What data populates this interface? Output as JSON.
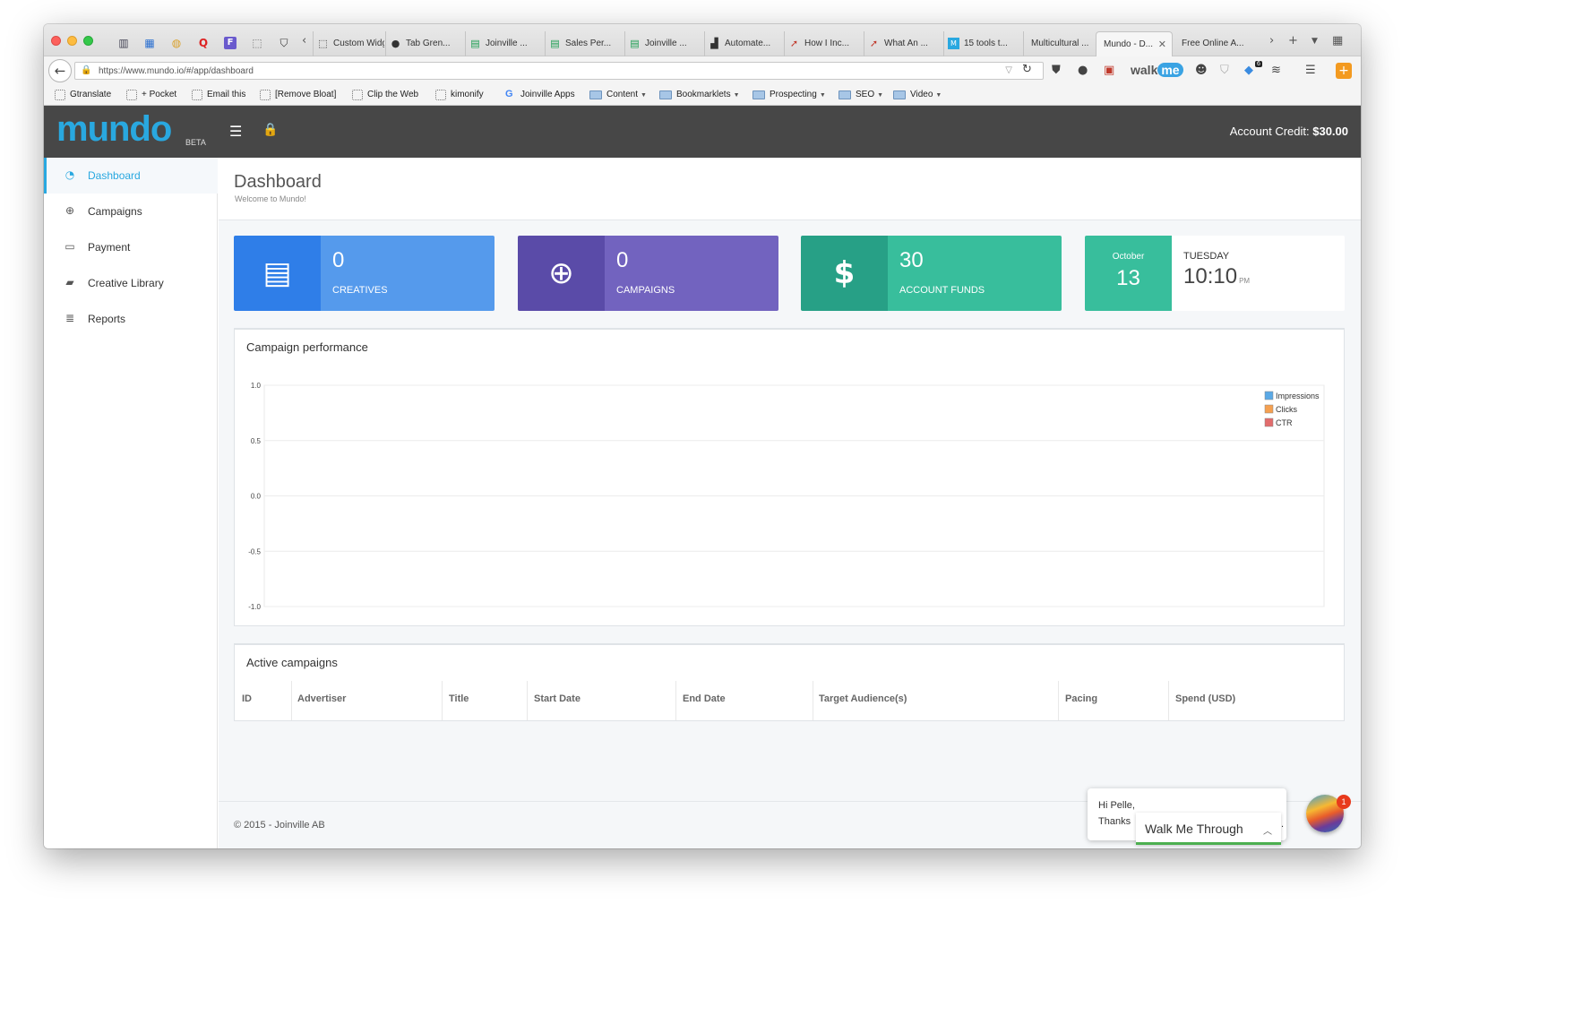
{
  "browser": {
    "tabs": [
      {
        "label": "Custom Widg...",
        "icon": "widget-icon"
      },
      {
        "label": "Tab Gren...",
        "icon": "grenade-icon"
      },
      {
        "label": "Joinville ...",
        "icon": "sheets-icon"
      },
      {
        "label": "Sales Per...",
        "icon": "sheets-icon"
      },
      {
        "label": "Joinville ...",
        "icon": "sheets-icon"
      },
      {
        "label": "Automate...",
        "icon": "chart-icon"
      },
      {
        "label": "How I Inc...",
        "icon": "rocket-icon"
      },
      {
        "label": "What An ...",
        "icon": "rocket-icon"
      },
      {
        "label": "15 tools t...",
        "icon": "doc-icon"
      },
      {
        "label": "Multicultural ...",
        "icon": "blank-icon"
      },
      {
        "label": "Mundo - D...",
        "icon": "blank-icon",
        "active": true
      },
      {
        "label": "Free Online A...",
        "icon": "blank-icon"
      }
    ],
    "url": "https://www.mundo.io/#/app/dashboard",
    "bookmarks": [
      {
        "label": "Gtranslate",
        "type": "page"
      },
      {
        "label": "+ Pocket",
        "type": "page"
      },
      {
        "label": "Email this",
        "type": "page"
      },
      {
        "label": "[Remove Bloat]",
        "type": "page"
      },
      {
        "label": "Clip the Web",
        "type": "page"
      },
      {
        "label": "kimonify",
        "type": "page"
      },
      {
        "label": "Joinville Apps",
        "type": "google"
      },
      {
        "label": "Content",
        "type": "folder"
      },
      {
        "label": "Bookmarklets",
        "type": "folder"
      },
      {
        "label": "Prospecting",
        "type": "folder"
      },
      {
        "label": "SEO",
        "type": "folder"
      },
      {
        "label": "Video",
        "type": "folder"
      }
    ],
    "extension_badge": "6"
  },
  "header": {
    "logo": "mundo",
    "beta": "BETA",
    "credit_label": "Account Credit:",
    "credit_value": "$30.00"
  },
  "sidebar": {
    "items": [
      {
        "label": "Dashboard",
        "icon": "gauge-icon",
        "active": true
      },
      {
        "label": "Campaigns",
        "icon": "globe-icon"
      },
      {
        "label": "Payment",
        "icon": "credit-card-icon"
      },
      {
        "label": "Creative Library",
        "icon": "book-icon"
      },
      {
        "label": "Reports",
        "icon": "database-icon"
      }
    ]
  },
  "page": {
    "title": "Dashboard",
    "subtitle": "Welcome to Mundo!"
  },
  "stats": {
    "creatives": {
      "value": "0",
      "label": "CREATIVES",
      "color": "#2f7ee8"
    },
    "campaigns": {
      "value": "0",
      "label": "CAMPAIGNS",
      "color": "#5a4ba8"
    },
    "funds": {
      "value": "30",
      "label": "ACCOUNT FUNDS",
      "color": "#27a086"
    },
    "date": {
      "month": "October",
      "day": "13",
      "weekday": "TUESDAY",
      "time": "10:10",
      "ampm": "PM"
    }
  },
  "chart": {
    "title": "Campaign performance"
  },
  "chart_data": {
    "type": "line",
    "title": "Campaign performance",
    "xlabel": "",
    "ylabel": "",
    "ylim": [
      -1.0,
      1.0
    ],
    "yticks": [
      "1.0",
      "0.5",
      "0.0",
      "-0.5",
      "-1.0"
    ],
    "grid": true,
    "legend_position": "top-right",
    "series": [
      {
        "name": "Impressions",
        "color": "#5aa9e6",
        "values": []
      },
      {
        "name": "Clicks",
        "color": "#f5a050",
        "values": []
      },
      {
        "name": "CTR",
        "color": "#e26c6c",
        "values": []
      }
    ]
  },
  "campaigns": {
    "title": "Active campaigns",
    "columns": [
      "ID",
      "Advertiser",
      "Title",
      "Start Date",
      "End Date",
      "Target Audience(s)",
      "Pacing",
      "Spend (USD)"
    ],
    "rows": []
  },
  "footer": {
    "text": "© 2015 - Joinville AB"
  },
  "walkme": {
    "greeting": "Hi Pelle,",
    "thanks": "Thanks",
    "button": "Walk Me Through",
    "badge": "1"
  }
}
